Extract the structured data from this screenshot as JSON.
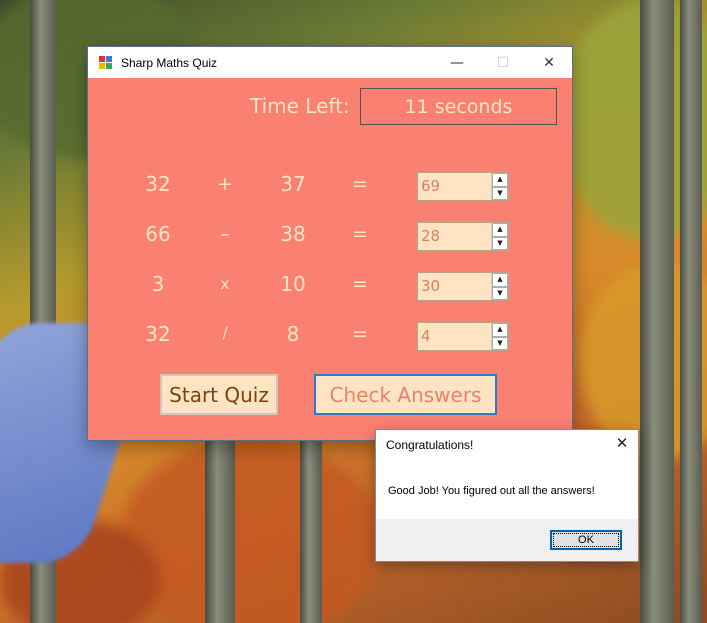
{
  "window": {
    "title": "Sharp Maths Quiz",
    "icon": "app-form-icon",
    "controls": {
      "minimize": "—",
      "maximize": "☐",
      "close": "✕"
    },
    "background_color": "#fa8072"
  },
  "timer": {
    "label": "Time Left:",
    "value": "11 seconds"
  },
  "problems": [
    {
      "left": "32",
      "operator": "+",
      "right": "37",
      "equals": "=",
      "answer": "69"
    },
    {
      "left": "66",
      "operator": "–",
      "right": "38",
      "equals": "=",
      "answer": "28"
    },
    {
      "left": "3",
      "operator": "x",
      "right": "10",
      "equals": "=",
      "answer": "30"
    },
    {
      "left": "32",
      "operator": "/",
      "right": "8",
      "equals": "=",
      "answer": "4"
    }
  ],
  "buttons": {
    "start": "Start Quiz",
    "check": "Check Answers"
  },
  "dialog": {
    "title": "Congratulations!",
    "close": "✕",
    "message": "Good Job! You figured out all the answers!",
    "ok": "OK"
  }
}
